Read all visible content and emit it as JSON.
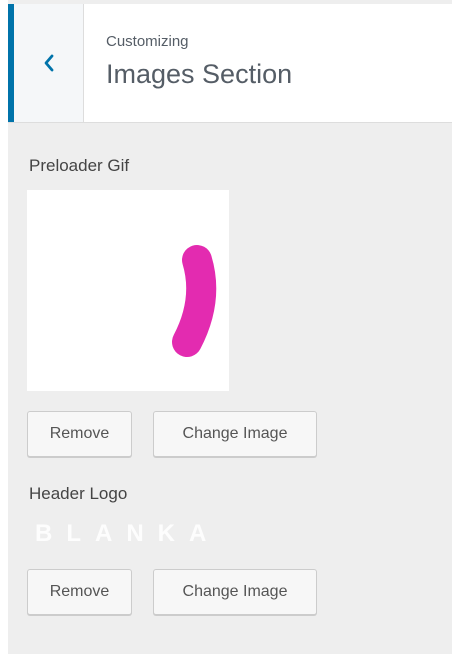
{
  "header": {
    "subtitle": "Customizing",
    "title": "Images Section"
  },
  "preloader": {
    "label": "Preloader Gif",
    "remove_label": "Remove",
    "change_label": "Change Image"
  },
  "header_logo": {
    "label": "Header Logo",
    "logo_text": "BLANKA",
    "remove_label": "Remove",
    "change_label": "Change Image"
  },
  "colors": {
    "accent": "#0073aa",
    "preloader_shape": "#e32bb0",
    "panel_bg": "#eeeeee"
  },
  "icons": {
    "back": "chevron-left-icon"
  }
}
